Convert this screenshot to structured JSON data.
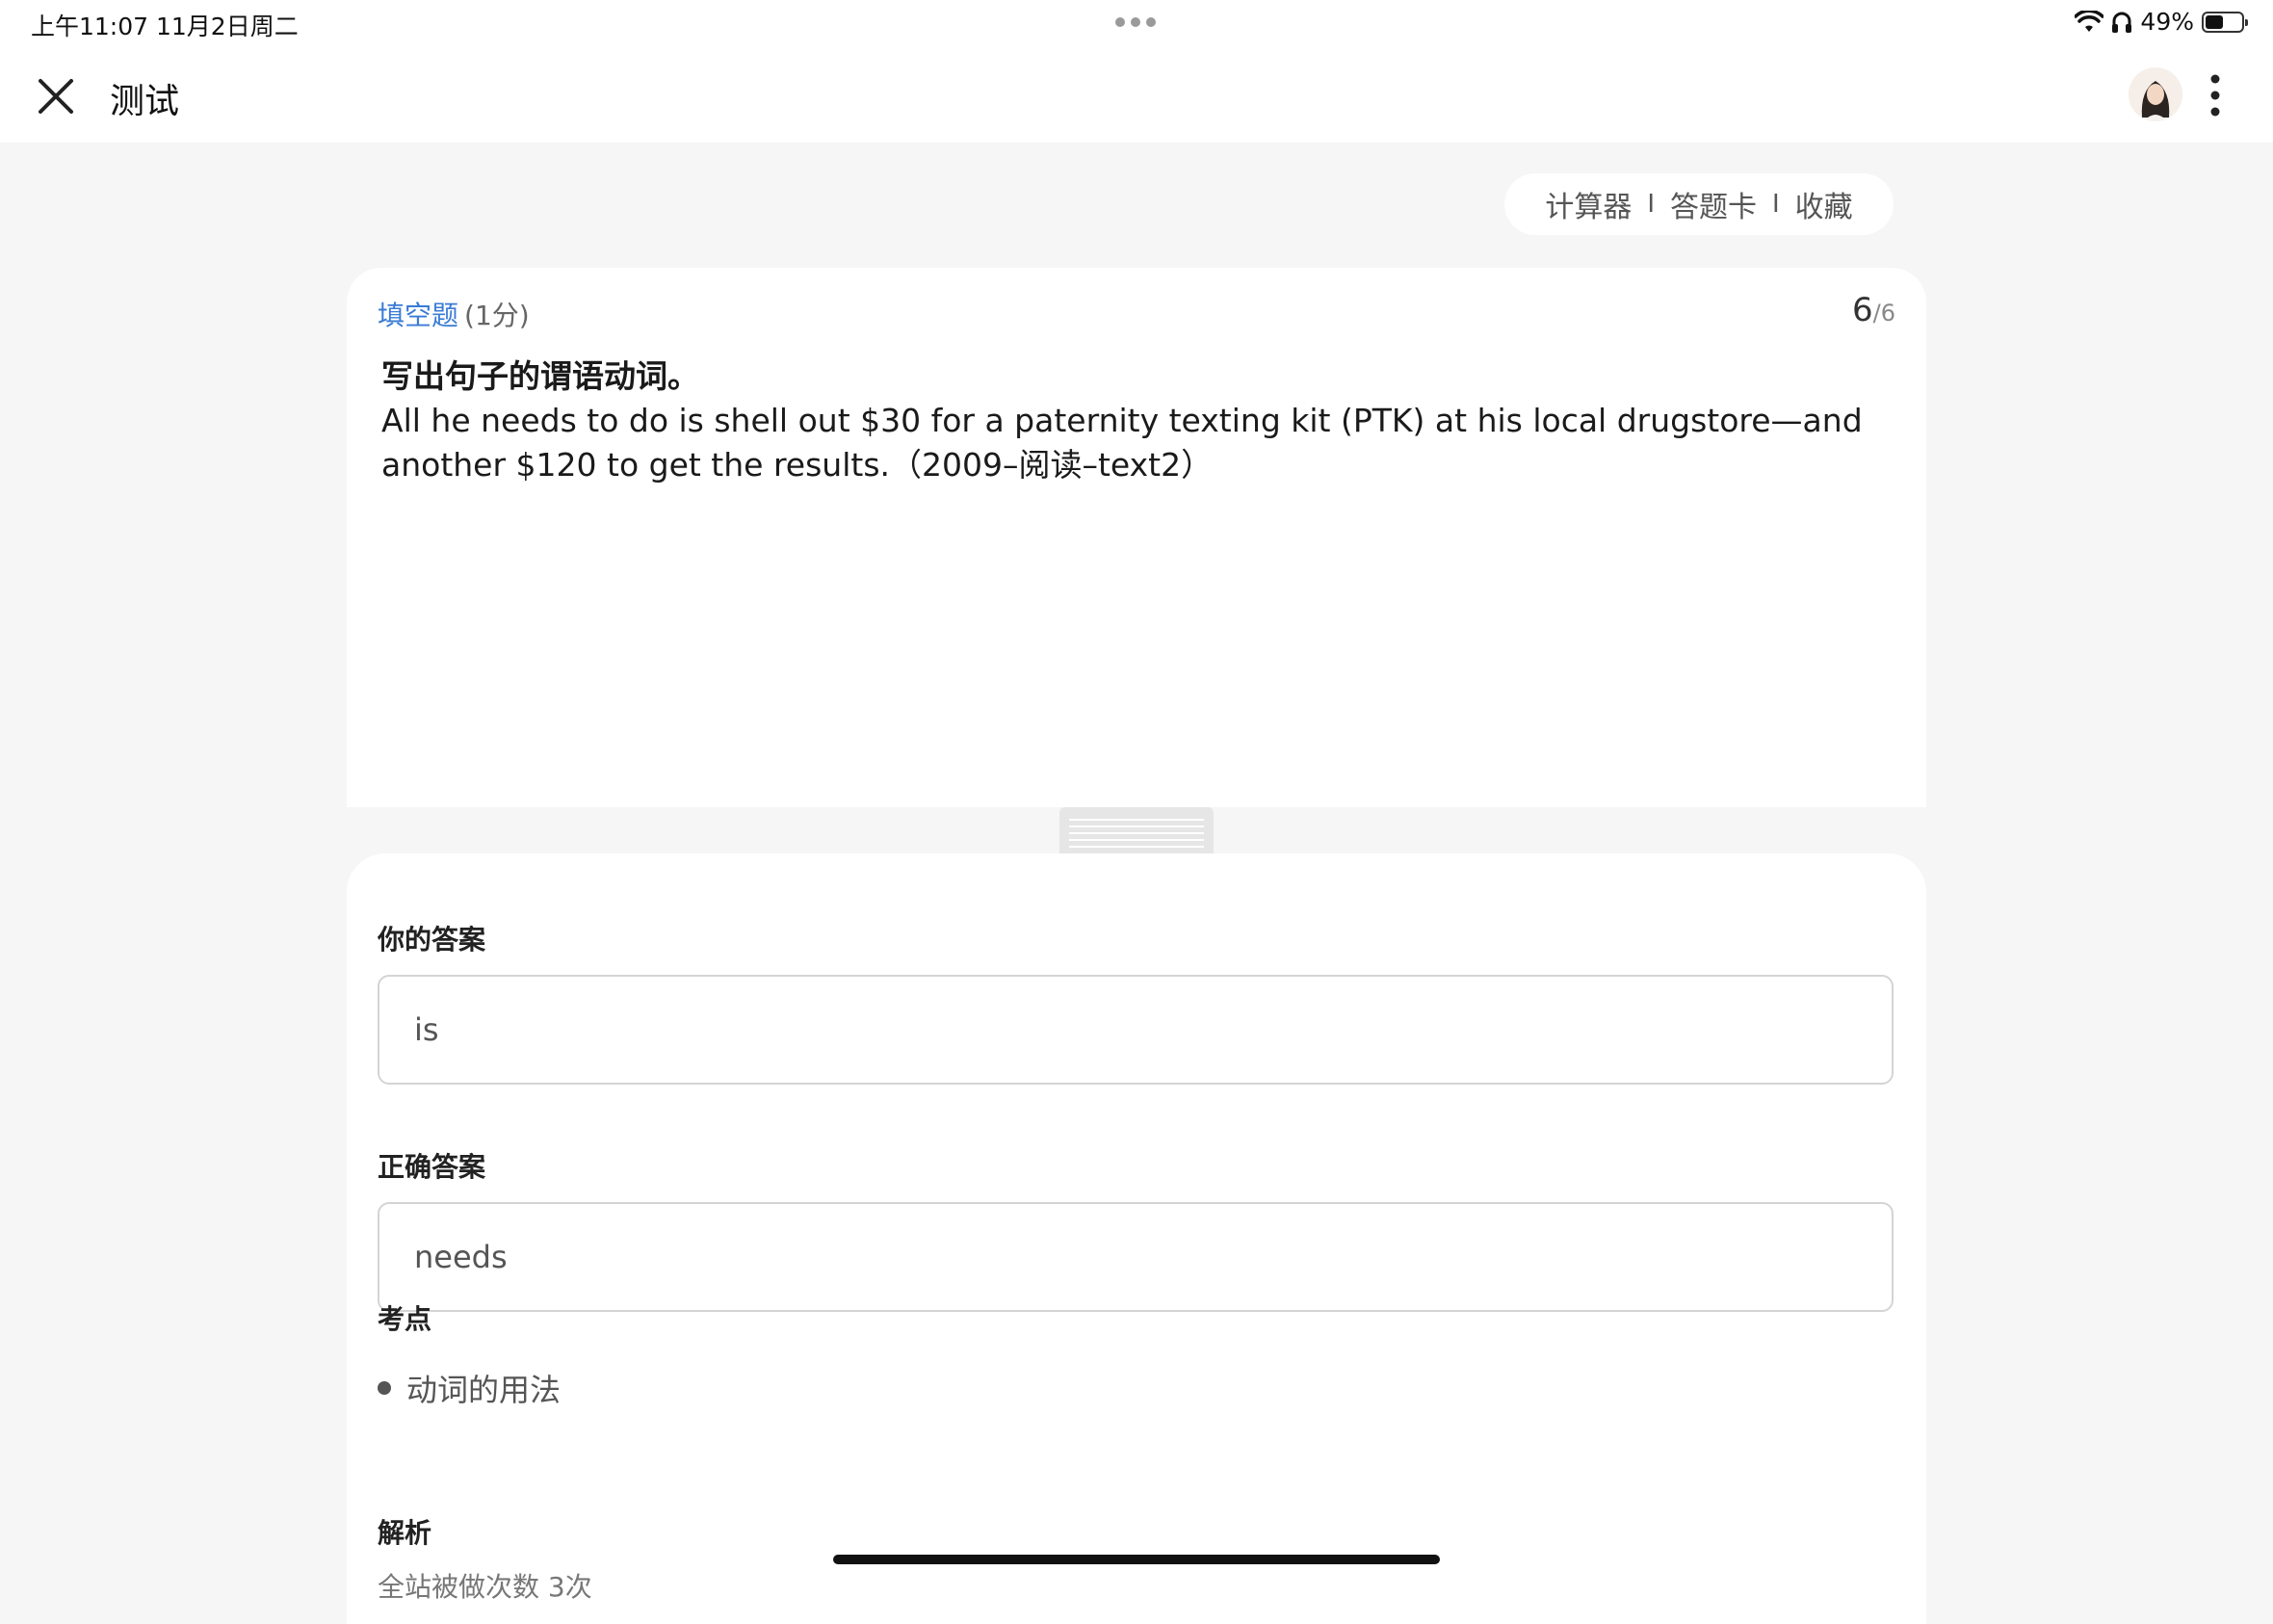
{
  "status_bar": {
    "time": "上午11:07   11月2日周二",
    "battery": "49%",
    "battery_level": 0.49
  },
  "nav": {
    "title": "测试"
  },
  "tools": {
    "calculator": "计算器",
    "answer_card": "答题卡",
    "favorite": "收藏",
    "separator": "I"
  },
  "question": {
    "type": "填空题",
    "score": "(1分)",
    "current": "6",
    "total": "/6",
    "prompt": "写出句子的谓语动词。",
    "text": "All he needs to do is shell out $30 for a paternity texting kit (PTK) at his local drugstore—and another $120 to get the results.（2009–阅读–text2）"
  },
  "answer": {
    "your_label": "你的答案",
    "your_value": "is",
    "correct_label": "正确答案",
    "correct_value": "needs",
    "kp_label": "考点",
    "kp_item": "动词的用法",
    "analysis_label": "解析",
    "analysis_sub": "全站被做次数 3次"
  },
  "colors": {
    "accent": "#3a7bd5",
    "background": "#f6f6f6"
  }
}
